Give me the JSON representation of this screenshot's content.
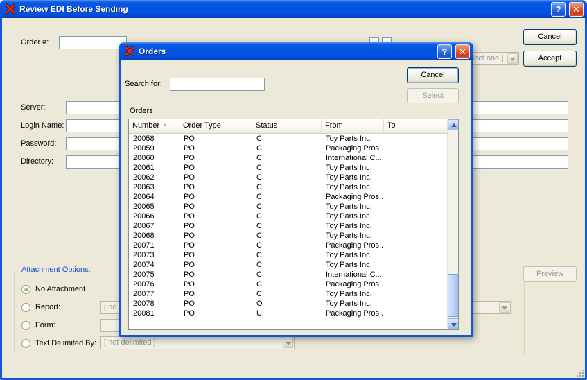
{
  "icons": {
    "help": "?",
    "close": "✕",
    "sort_ascending": "▲"
  },
  "colors": {
    "titlebar_blue": "#0353e4",
    "window_border": "#0f57d8",
    "body_bg": "#ece9d8",
    "close_button_red": "#cc3a14",
    "groupbox_label_blue": "#0b46c8",
    "input_border": "#7f9db9"
  },
  "main_window": {
    "title": "Review EDI Before Sending",
    "order_label": "Order #:",
    "order_value": "",
    "select_one_combo": "[ select one ]",
    "cancel_button": "Cancel",
    "accept_button": "Accept",
    "server_label": "Server:",
    "server_value": "",
    "login_label": "Login Name:",
    "login_value": "",
    "password_label": "Password:",
    "password_value": "",
    "directory_label": "Directory:",
    "directory_value": "",
    "attachment": {
      "group_label": "Attachment Options:",
      "options": [
        {
          "label": "No Attachment",
          "selected": true
        },
        {
          "label": "Report:",
          "selected": false,
          "combo_value": "[ no report ]"
        },
        {
          "label": "Form:",
          "selected": false,
          "combo_value": ""
        },
        {
          "label": "Text Delimited By:",
          "selected": false,
          "combo_value": "[ not delimited ]"
        }
      ]
    },
    "preview_button": "Preview"
  },
  "orders_dialog": {
    "title": "Orders",
    "search_label": "Search for:",
    "search_value": "",
    "cancel_button": "Cancel",
    "select_button": "Select",
    "list_label": "Orders",
    "table": {
      "columns": [
        "Number",
        "Order Type",
        "Status",
        "From",
        "To"
      ],
      "sorted_by": "Number",
      "sort_ascending": true,
      "rows": [
        [
          "20058",
          "PO",
          "C",
          "Toy Parts Inc.",
          ""
        ],
        [
          "20059",
          "PO",
          "C",
          "Packaging Pros...",
          ""
        ],
        [
          "20060",
          "PO",
          "C",
          "International C...",
          ""
        ],
        [
          "20061",
          "PO",
          "C",
          "Toy Parts Inc.",
          ""
        ],
        [
          "20062",
          "PO",
          "C",
          "Toy Parts Inc.",
          ""
        ],
        [
          "20063",
          "PO",
          "C",
          "Toy Parts Inc.",
          ""
        ],
        [
          "20064",
          "PO",
          "C",
          "Packaging Pros...",
          ""
        ],
        [
          "20065",
          "PO",
          "C",
          "Toy Parts Inc.",
          ""
        ],
        [
          "20066",
          "PO",
          "C",
          "Toy Parts Inc.",
          ""
        ],
        [
          "20067",
          "PO",
          "C",
          "Toy Parts Inc.",
          ""
        ],
        [
          "20068",
          "PO",
          "C",
          "Toy Parts Inc.",
          ""
        ],
        [
          "20071",
          "PO",
          "C",
          "Packaging Pros...",
          ""
        ],
        [
          "20073",
          "PO",
          "C",
          "Toy Parts Inc.",
          ""
        ],
        [
          "20074",
          "PO",
          "C",
          "Toy Parts Inc.",
          ""
        ],
        [
          "20075",
          "PO",
          "C",
          "International C...",
          ""
        ],
        [
          "20076",
          "PO",
          "C",
          "Packaging Pros...",
          ""
        ],
        [
          "20077",
          "PO",
          "C",
          "Toy Parts Inc.",
          ""
        ],
        [
          "20078",
          "PO",
          "O",
          "Toy Parts Inc.",
          ""
        ],
        [
          "20081",
          "PO",
          "U",
          "Packaging Pros...",
          ""
        ]
      ]
    }
  }
}
